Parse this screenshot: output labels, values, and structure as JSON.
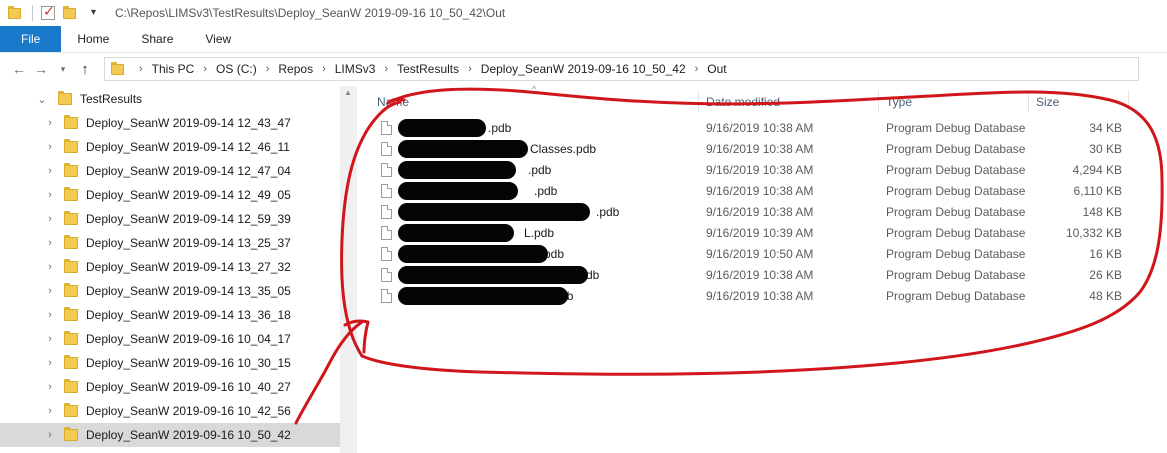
{
  "window": {
    "title_path": "C:\\Repos\\LIMSv3\\TestResults\\Deploy_SeanW 2019-09-16 10_50_42\\Out"
  },
  "ribbon": {
    "tabs": [
      {
        "label": "File"
      },
      {
        "label": "Home"
      },
      {
        "label": "Share"
      },
      {
        "label": "View"
      }
    ]
  },
  "nav": {
    "back_icon": "back-arrow-icon",
    "forward_icon": "forward-arrow-icon",
    "recent_icon": "chevron-down-icon",
    "up_icon": "up-arrow-icon"
  },
  "address": {
    "crumbs": [
      {
        "label": "This PC"
      },
      {
        "label": "OS (C:)"
      },
      {
        "label": "Repos"
      },
      {
        "label": "LIMSv3"
      },
      {
        "label": "TestResults"
      },
      {
        "label": "Deploy_SeanW 2019-09-16 10_50_42"
      },
      {
        "label": "Out"
      }
    ]
  },
  "tree": {
    "parent": {
      "label": "TestResults",
      "expanded": true
    },
    "children": [
      {
        "label": "Deploy_SeanW 2019-09-14 12_43_47"
      },
      {
        "label": "Deploy_SeanW 2019-09-14 12_46_11"
      },
      {
        "label": "Deploy_SeanW 2019-09-14 12_47_04"
      },
      {
        "label": "Deploy_SeanW 2019-09-14 12_49_05"
      },
      {
        "label": "Deploy_SeanW 2019-09-14 12_59_39"
      },
      {
        "label": "Deploy_SeanW 2019-09-14 13_25_37"
      },
      {
        "label": "Deploy_SeanW 2019-09-14 13_27_32"
      },
      {
        "label": "Deploy_SeanW 2019-09-14 13_35_05"
      },
      {
        "label": "Deploy_SeanW 2019-09-14 13_36_18"
      },
      {
        "label": "Deploy_SeanW 2019-09-16 10_04_17"
      },
      {
        "label": "Deploy_SeanW 2019-09-16 10_30_15"
      },
      {
        "label": "Deploy_SeanW 2019-09-16 10_40_27"
      },
      {
        "label": "Deploy_SeanW 2019-09-16 10_42_56"
      },
      {
        "label": "Deploy_SeanW 2019-09-16 10_50_42",
        "selected": true
      }
    ]
  },
  "columns": {
    "name": "Name",
    "date": "Date modified",
    "type": "Type",
    "size": "Size"
  },
  "files": [
    {
      "name_visible": ".pdb",
      "date": "9/16/2019 10:38 AM",
      "type": "Program Debug Database",
      "size": "34 KB"
    },
    {
      "name_visible": "Classes.pdb",
      "date": "9/16/2019 10:38 AM",
      "type": "Program Debug Database",
      "size": "30 KB"
    },
    {
      "name_visible": ".pdb",
      "date": "9/16/2019 10:38 AM",
      "type": "Program Debug Database",
      "size": "4,294 KB"
    },
    {
      "name_visible": ".pdb",
      "date": "9/16/2019 10:38 AM",
      "type": "Program Debug Database",
      "size": "6,110 KB"
    },
    {
      "name_visible": ".pdb",
      "date": "9/16/2019 10:38 AM",
      "type": "Program Debug Database",
      "size": "148 KB"
    },
    {
      "name_visible": "L.pdb",
      "date": "9/16/2019 10:39 AM",
      "type": "Program Debug Database",
      "size": "10,332 KB"
    },
    {
      "name_visible": "pdb",
      "date": "9/16/2019 10:50 AM",
      "type": "Program Debug Database",
      "size": "16 KB"
    },
    {
      "name_visible": ".pdb",
      "date": "9/16/2019 10:38 AM",
      "type": "Program Debug Database",
      "size": "26 KB"
    },
    {
      "name_visible": "alization.pdb",
      "date": "9/16/2019 10:38 AM",
      "type": "Program Debug Database",
      "size": "48 KB"
    }
  ],
  "colors": {
    "file_tab": "#1979ca",
    "annotation": "#d0161a",
    "selection": "#d9d9d9",
    "folder": "#f3c951"
  }
}
